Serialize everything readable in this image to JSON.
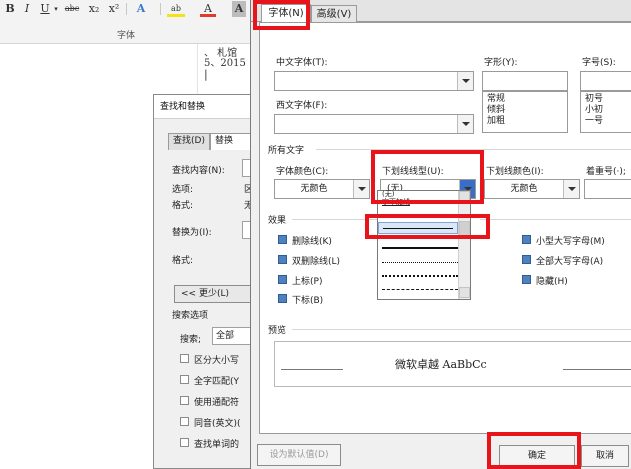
{
  "ribbon": {
    "buttons": [
      "B",
      "I",
      "U",
      "abc",
      "x₂",
      "x²",
      "A",
      "ab",
      "A",
      "A"
    ],
    "group_label": "字体"
  },
  "document": {
    "lines": [
      "、 札馆",
      "5、2015"
    ]
  },
  "find_dialog": {
    "title": "查找和替换",
    "tabs": [
      "查找(D)",
      "替换"
    ],
    "find_label": "查找内容(N):",
    "options_label": "选项:",
    "format_label": "格式:",
    "options_value": "区",
    "format_value": "无",
    "replace_label": "替换为(I):",
    "replace_format_label": "格式:",
    "less_button": "<< 更少(L)",
    "search_options_label": "搜索选项",
    "search_label": "搜索;",
    "search_value": "全部",
    "checkboxes": [
      "区分大小写",
      "全字匹配(Y",
      "使用通配符",
      "同音(英文)(",
      "查找单词的"
    ]
  },
  "font_dialog": {
    "tabs": {
      "font": "字体(N)",
      "advanced": "高级(V)"
    },
    "chinese_font_label": "中文字体(T):",
    "western_font_label": "西文字体(F):",
    "style_label": "字形(Y):",
    "size_label": "字号(S):",
    "styles": [
      "常规",
      "倾斜",
      "加粗"
    ],
    "sizes": [
      "初号",
      "小初",
      "一号"
    ],
    "all_text_label": "所有文字",
    "font_color_label": "字体颜色(C):",
    "font_color_value": "无颜色",
    "underline_type_label": "下划线线型(U):",
    "underline_type_value": "(无)",
    "underline_color_label": "下划线颜色(I):",
    "underline_color_value": "无颜色",
    "emphasis_label": "着重号(·);",
    "effects_label": "效果",
    "effects_left": [
      "删除线(K)",
      "双删除线(L)",
      "上标(P)",
      "下标(B)"
    ],
    "effects_right": [
      "小型大写字母(M)",
      "全部大写字母(A)",
      "隐藏(H)"
    ],
    "underline_list_items": [
      "(无)",
      "字下加线"
    ],
    "preview_label": "预览",
    "preview_text": "微软卓越 AaBbCc",
    "default_button": "设为默认值(D)",
    "ok_button": "确定",
    "cancel_button": "取消"
  },
  "colors": {
    "highlight": "#e8141b",
    "checkbox_fill": "#4f81bd",
    "dialog_bg": "#f0f0f0"
  }
}
